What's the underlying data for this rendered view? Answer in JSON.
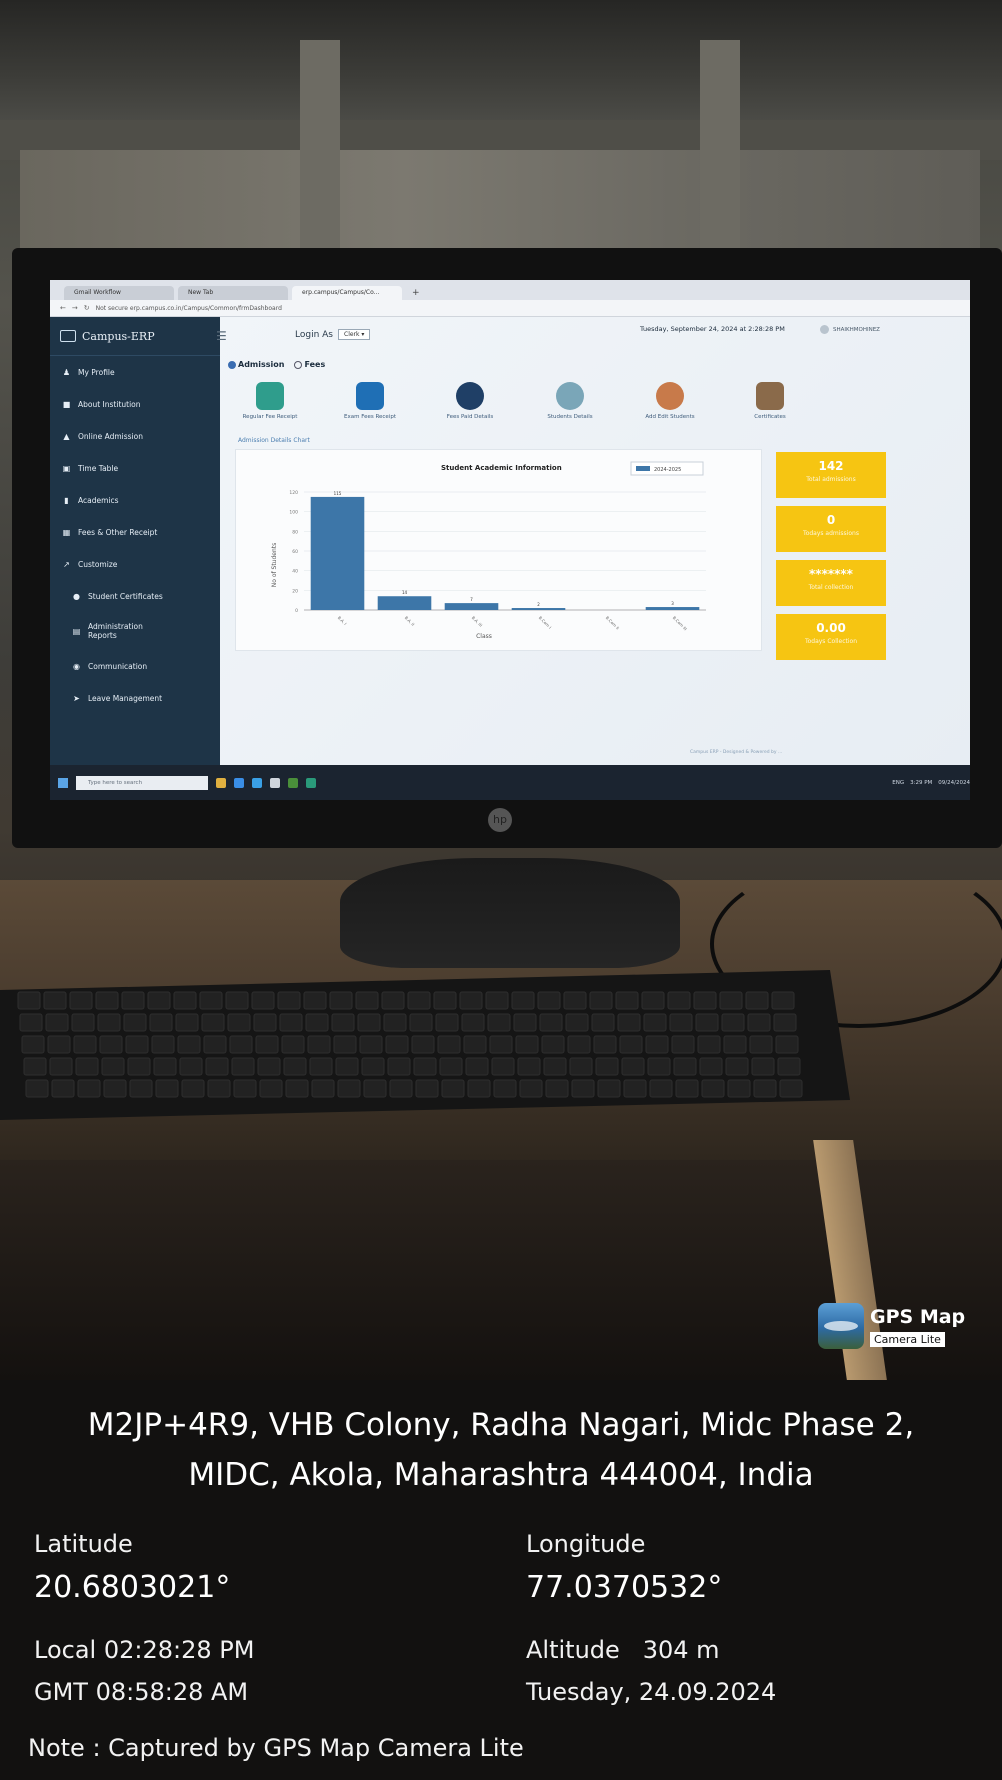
{
  "browser": {
    "tabs": [
      "Gmail Workflow",
      "New Tab",
      "erp.campus/Campus/Co...",
      "+"
    ],
    "address": "Not secure   erp.campus.co.in/Campus/Common/frmDashboard"
  },
  "app": {
    "brand": "Campus-ERP",
    "login_as_label": "Login As",
    "login_as_value": "Clerk",
    "datetime": "Tuesday, September 24, 2024 at 2:28:28 PM",
    "user": "SHAIKHMOHINEZ"
  },
  "sidebar": {
    "items": [
      {
        "icon": "user-icon",
        "label": "My Profile"
      },
      {
        "icon": "building-icon",
        "label": "About Institution"
      },
      {
        "icon": "graduation-icon",
        "label": "Online Admission"
      },
      {
        "icon": "calendar-icon",
        "label": "Time Table"
      },
      {
        "icon": "book-icon",
        "label": "Academics"
      },
      {
        "icon": "receipt-icon",
        "label": "Fees & Other Receipt"
      },
      {
        "icon": "chart-icon",
        "label": "Customize"
      },
      {
        "icon": "dot-icon",
        "label": "Student Certificates"
      },
      {
        "icon": "report-icon",
        "label": "Administration Reports"
      },
      {
        "icon": "chat-icon",
        "label": "Communication"
      },
      {
        "icon": "arrow-icon",
        "label": "Leave Management"
      }
    ]
  },
  "radios": {
    "admission": "Admission",
    "fees": "Fees",
    "selected": "admission"
  },
  "quick_links": [
    {
      "label": "Regular Fee Receipt",
      "color": "#2f9d8c"
    },
    {
      "label": "Exam Fees Receipt",
      "color": "#1f6fb5"
    },
    {
      "label": "Fees Paid Details",
      "color": "#1f3f66"
    },
    {
      "label": "Students Details",
      "color": "#7aa6b8"
    },
    {
      "label": "Add Edit Students",
      "color": "#c87a4a"
    },
    {
      "label": "Certificates",
      "color": "#8a6a4a"
    }
  ],
  "admission_link": "Admission Details Chart",
  "chart_data": {
    "type": "bar",
    "title": "Student Academic Information",
    "xlabel": "Class",
    "ylabel": "No of Students",
    "ylim": [
      0,
      120
    ],
    "yticks": [
      0,
      20,
      40,
      60,
      80,
      100,
      120
    ],
    "categories": [
      "B.A. I",
      "B.A. II",
      "B.A. III",
      "B.Com I",
      "B.Com II",
      "B.Com III"
    ],
    "series": [
      {
        "name": "2024-2025",
        "values": [
          115,
          14,
          7,
          2,
          0,
          3
        ],
        "color": "#3d76a8"
      }
    ],
    "data_labels": [
      "115",
      "14",
      "7",
      "2",
      "",
      "3"
    ],
    "legend": "top-right",
    "grid": true
  },
  "stats": [
    {
      "value": "142",
      "label": "Total admissions"
    },
    {
      "value": "0",
      "label": "Todays admissions"
    },
    {
      "value": "*******",
      "label": "Total collection"
    },
    {
      "value": "0.00",
      "label": "Todays Collection"
    }
  ],
  "footer_note": "Campus ERP - Designed & Powered by ...",
  "taskbar": {
    "search": "Type here to search",
    "time": "3:29 PM",
    "date": "09/24/2024",
    "lang": "ENG"
  },
  "gps": {
    "badge_title": "GPS Map",
    "badge_sub": "Camera Lite",
    "address_line1": "M2JP+4R9, VHB Colony, Radha Nagari, Midc Phase 2,",
    "address_line2": "MIDC, Akola, Maharashtra 444004, India",
    "lat_label": "Latitude",
    "lat_value": "20.6803021°",
    "lon_label": "Longitude",
    "lon_value": "77.0370532°",
    "local_time": "Local 02:28:28 PM",
    "gmt_time": "GMT 08:58:28 AM",
    "altitude_label": "Altitude",
    "altitude_value": "304 m",
    "date": "Tuesday, 24.09.2024",
    "note": "Note : Captured by GPS Map Camera Lite"
  }
}
